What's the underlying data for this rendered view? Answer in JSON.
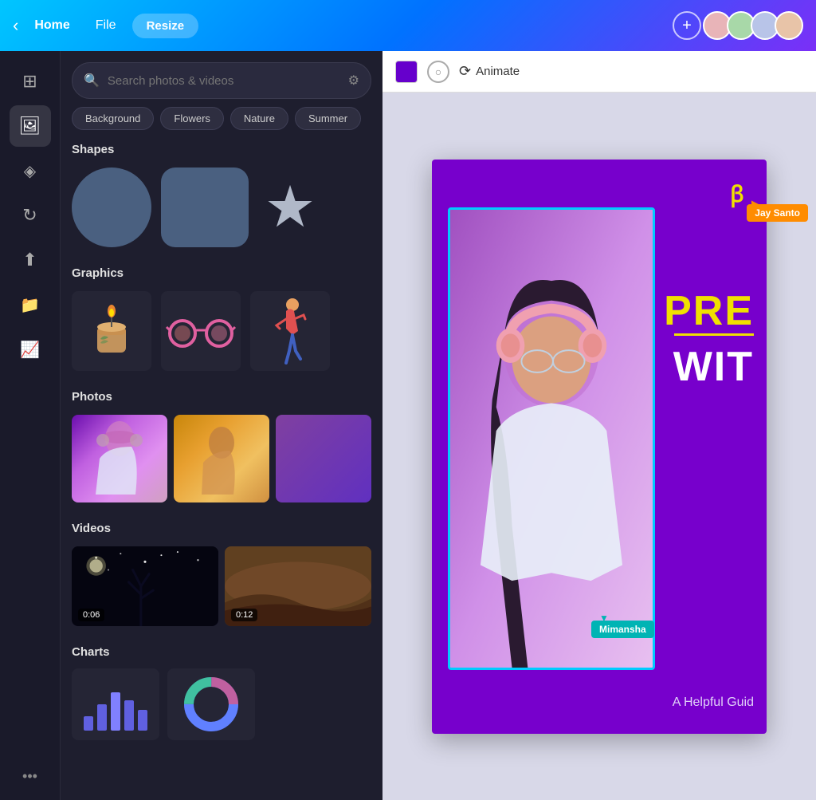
{
  "nav": {
    "back_label": "‹",
    "home_label": "Home",
    "file_label": "File",
    "resize_label": "Resize",
    "add_label": "+",
    "avatars": [
      {
        "id": "avatar-1",
        "initials": ""
      },
      {
        "id": "avatar-2",
        "initials": ""
      },
      {
        "id": "avatar-3",
        "initials": ""
      },
      {
        "id": "avatar-4",
        "initials": ""
      }
    ]
  },
  "sidebar_icons": [
    {
      "id": "layout-icon",
      "symbol": "⊞",
      "active": false
    },
    {
      "id": "image-icon",
      "symbol": "🖼",
      "active": true
    },
    {
      "id": "shapes-icon",
      "symbol": "◇",
      "active": false
    },
    {
      "id": "refresh-icon",
      "symbol": "↻",
      "active": false
    },
    {
      "id": "upload-icon",
      "symbol": "↑",
      "active": false
    },
    {
      "id": "folder-icon",
      "symbol": "📁",
      "active": false
    },
    {
      "id": "chart-icon",
      "symbol": "📈",
      "active": false
    },
    {
      "id": "more-icon",
      "symbol": "•••",
      "active": false
    }
  ],
  "panel": {
    "search": {
      "placeholder": "Search photos & videos",
      "filter_icon": "⚙"
    },
    "tags": [
      "Background",
      "Flowers",
      "Nature",
      "Summer"
    ],
    "sections": {
      "shapes": {
        "title": "Shapes",
        "items": [
          "circle",
          "rounded-rect",
          "star"
        ]
      },
      "graphics": {
        "title": "Graphics",
        "items": [
          "candle",
          "glasses",
          "runner"
        ]
      },
      "photos": {
        "title": "Photos",
        "items": [
          "photo-girl-headphones",
          "photo-person-yellow",
          "photo-purple"
        ]
      },
      "videos": {
        "title": "Videos",
        "items": [
          {
            "label": "0:06",
            "type": "night"
          },
          {
            "label": "0:12",
            "type": "desert"
          }
        ]
      },
      "charts": {
        "title": "Charts"
      }
    }
  },
  "toolbar": {
    "color_swatch": "#6600cc",
    "animate_label": "Animate"
  },
  "canvas": {
    "design": {
      "background_color": "#7700cc",
      "logo_text": "⊂⊃",
      "text_yellow": "PRE",
      "text_white": "WIT",
      "subtitle": "A Helpful Guid",
      "cursor_jay": "Jay Santo",
      "cursor_mimansha": "Mimansha"
    }
  }
}
